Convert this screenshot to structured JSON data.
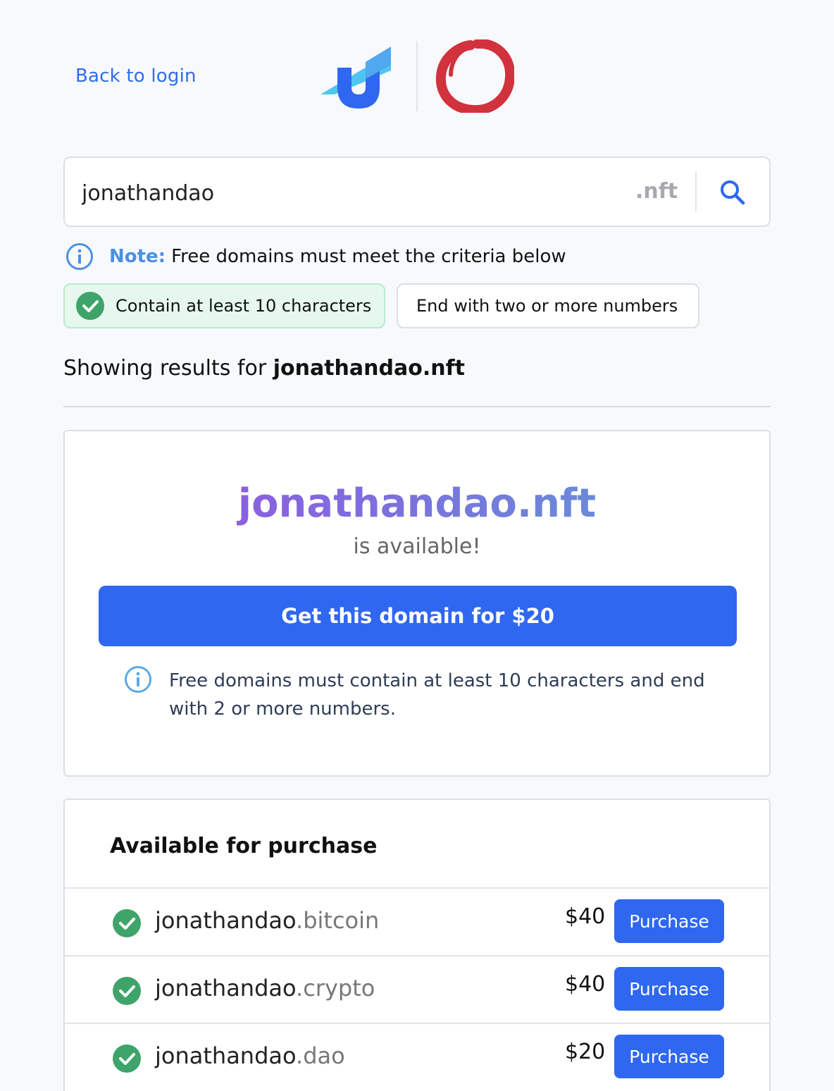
{
  "header": {
    "back_link": "Back to login",
    "logos": [
      "unstoppable-domains-logo",
      "enso-ring-logo"
    ]
  },
  "search": {
    "value": "jonathandao",
    "tld": ".nft",
    "icon": "search-icon"
  },
  "note": {
    "label": "Note:",
    "text": "Free domains must meet the criteria below"
  },
  "criteria": [
    {
      "label": "Contain at least 10 characters",
      "met": true
    },
    {
      "label": "End with two or more numbers",
      "met": false
    }
  ],
  "results": {
    "prefix": "Showing results for",
    "query": "jonathandao.nft"
  },
  "availability": {
    "domain": "jonathandao.nft",
    "status": "is available!",
    "button": "Get this domain for $20",
    "info": "Free domains must contain at least 10 characters and end with 2 or more numbers."
  },
  "purchase": {
    "title": "Available for purchase",
    "items": [
      {
        "name": "jonathandao",
        "ext": ".bitcoin",
        "price": "$40",
        "button": "Purchase"
      },
      {
        "name": "jonathandao",
        "ext": ".crypto",
        "price": "$40",
        "button": "Purchase"
      },
      {
        "name": "jonathandao",
        "ext": ".dao",
        "price": "$20",
        "button": "Purchase"
      }
    ]
  },
  "colors": {
    "accent": "#2f67f0",
    "link": "#2f6ee8",
    "success": "#3fa46a",
    "success_bg": "#e6f8ee",
    "logo_red": "#d1323e"
  }
}
